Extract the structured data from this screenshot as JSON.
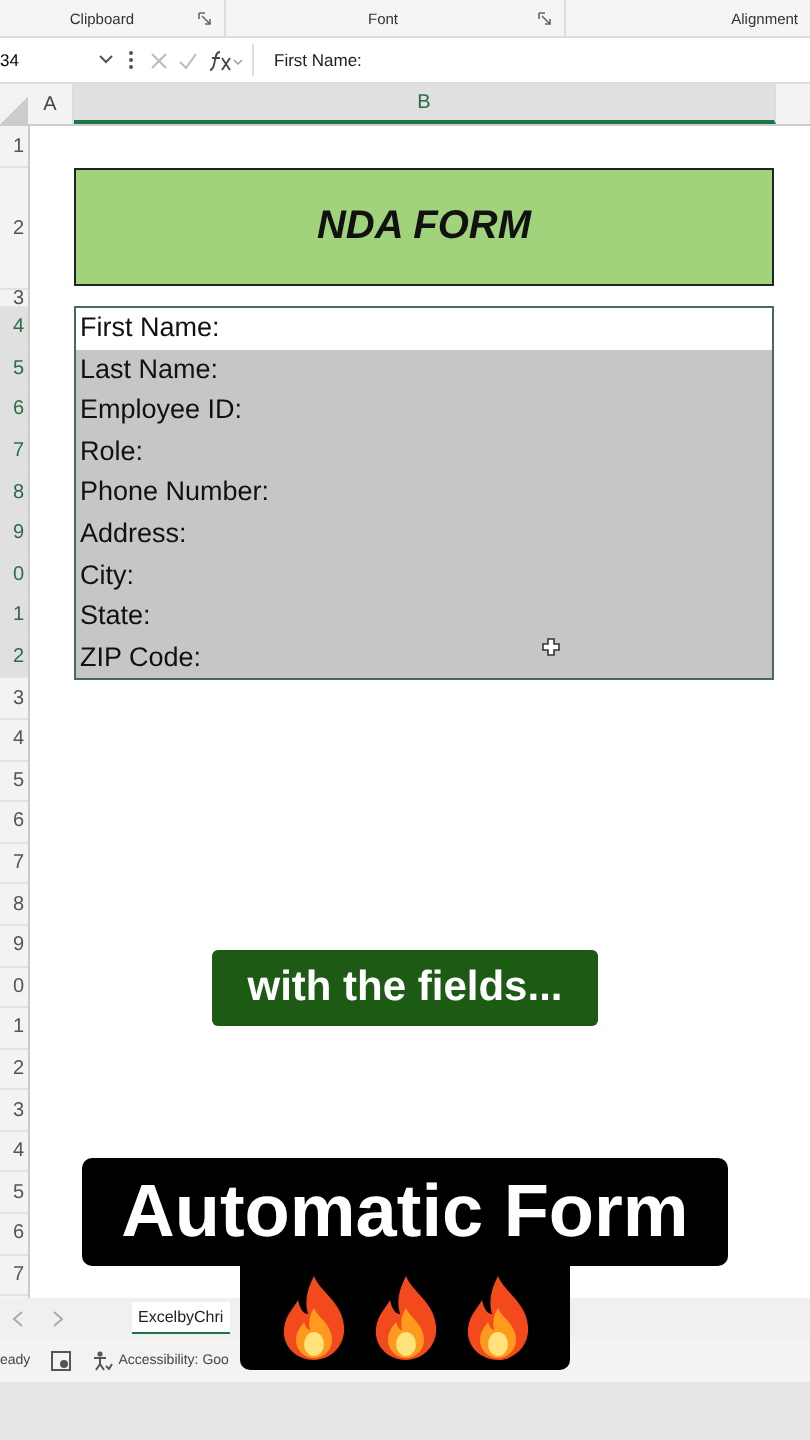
{
  "ribbon_groups": [
    {
      "label": "Clipboard",
      "launcher": true
    },
    {
      "label": "Font",
      "launcher": true
    },
    {
      "label": "Alignment",
      "launcher": false
    }
  ],
  "formula_bar": {
    "name_box": "34",
    "formula": "First Name:"
  },
  "columns": [
    {
      "label": "A",
      "selected": false
    },
    {
      "label": "B",
      "selected": true
    }
  ],
  "rows": [
    "1",
    "2",
    "3",
    "4",
    "5",
    "6",
    "7",
    "8",
    "9",
    "0",
    "1",
    "2",
    "3",
    "4",
    "5",
    "6",
    "7",
    "8",
    "9",
    "0",
    "1",
    "2",
    "3",
    "4",
    "5",
    "6",
    "7"
  ],
  "title": "NDA FORM",
  "fields": [
    {
      "label": "First Name:",
      "active": true
    },
    {
      "label": "Last Name:",
      "active": false
    },
    {
      "label": "Employee ID:",
      "active": false
    },
    {
      "label": "Role:",
      "active": false
    },
    {
      "label": "Phone Number:",
      "active": false
    },
    {
      "label": "Address:",
      "active": false
    },
    {
      "label": "City:",
      "active": false
    },
    {
      "label": "State:",
      "active": false
    },
    {
      "label": "ZIP Code:",
      "active": false
    }
  ],
  "sheet_tab": "ExcelbyChri",
  "status": {
    "mode": "eady",
    "accessibility": "Accessibility: Goo"
  },
  "captions": [
    {
      "text": "with the fields...",
      "kind": "green"
    },
    {
      "text": "Automatic Form",
      "kind": "black"
    }
  ]
}
